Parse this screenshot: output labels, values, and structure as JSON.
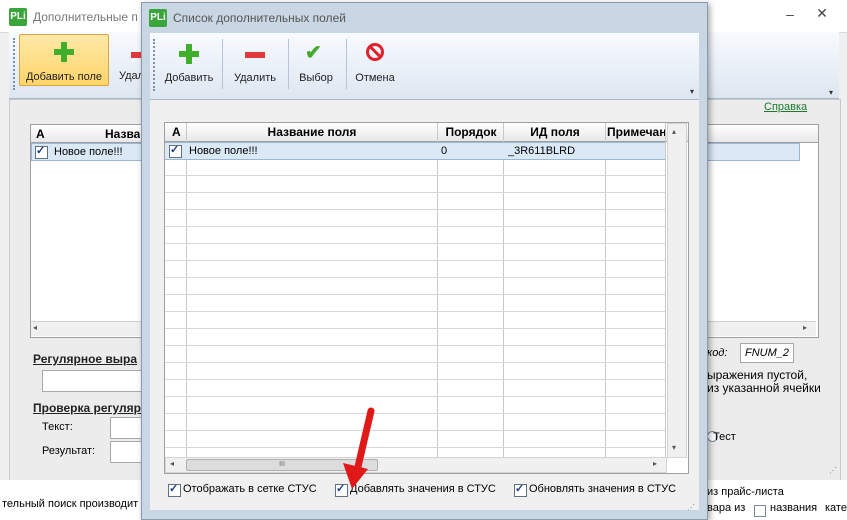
{
  "bg": {
    "title": "Дополнительные п",
    "toolbar": {
      "add": "Добавить поле",
      "delete": "Удал"
    },
    "help_link": "Справка",
    "grid": {
      "col_a": "А",
      "col_name": "Назва",
      "row1_name": "Новое поле!!!"
    },
    "regex_label": "Регулярное выра",
    "check_label": "Проверка регуляр",
    "text_label": "Текст:",
    "result_label": "Результат:",
    "code_label": "код:",
    "code_value": "FNUM_2",
    "note_line1": "ыражения пустой,",
    "note_line2": "из указанной ячейки",
    "test_label": "Тест",
    "bottom_left": "тельный поиск производит",
    "bottom_right1": "из прайс-листа",
    "bottom_right2": "вара из",
    "bottom_right3": "названия",
    "bottom_right4": "кате"
  },
  "dialog": {
    "title": "Список дополнительных полей",
    "toolbar": {
      "add": "Добавить",
      "delete": "Удалить",
      "select": "Выбор",
      "cancel": "Отмена"
    },
    "columns": {
      "a": "А",
      "name": "Название поля",
      "order": "Порядок",
      "id": "ИД поля",
      "note": "Примечан"
    },
    "rows": [
      {
        "checked": true,
        "name": "Новое поле!!!",
        "order": "0",
        "id": "_3R611BLRD",
        "note": ""
      }
    ],
    "scroll_thumb": "III",
    "checkboxes": {
      "show_grid": "Отображать в сетке СТУС",
      "add_values": "Добавлять значения в СТУС",
      "update_values": "Обновлять значения в СТУС"
    }
  }
}
